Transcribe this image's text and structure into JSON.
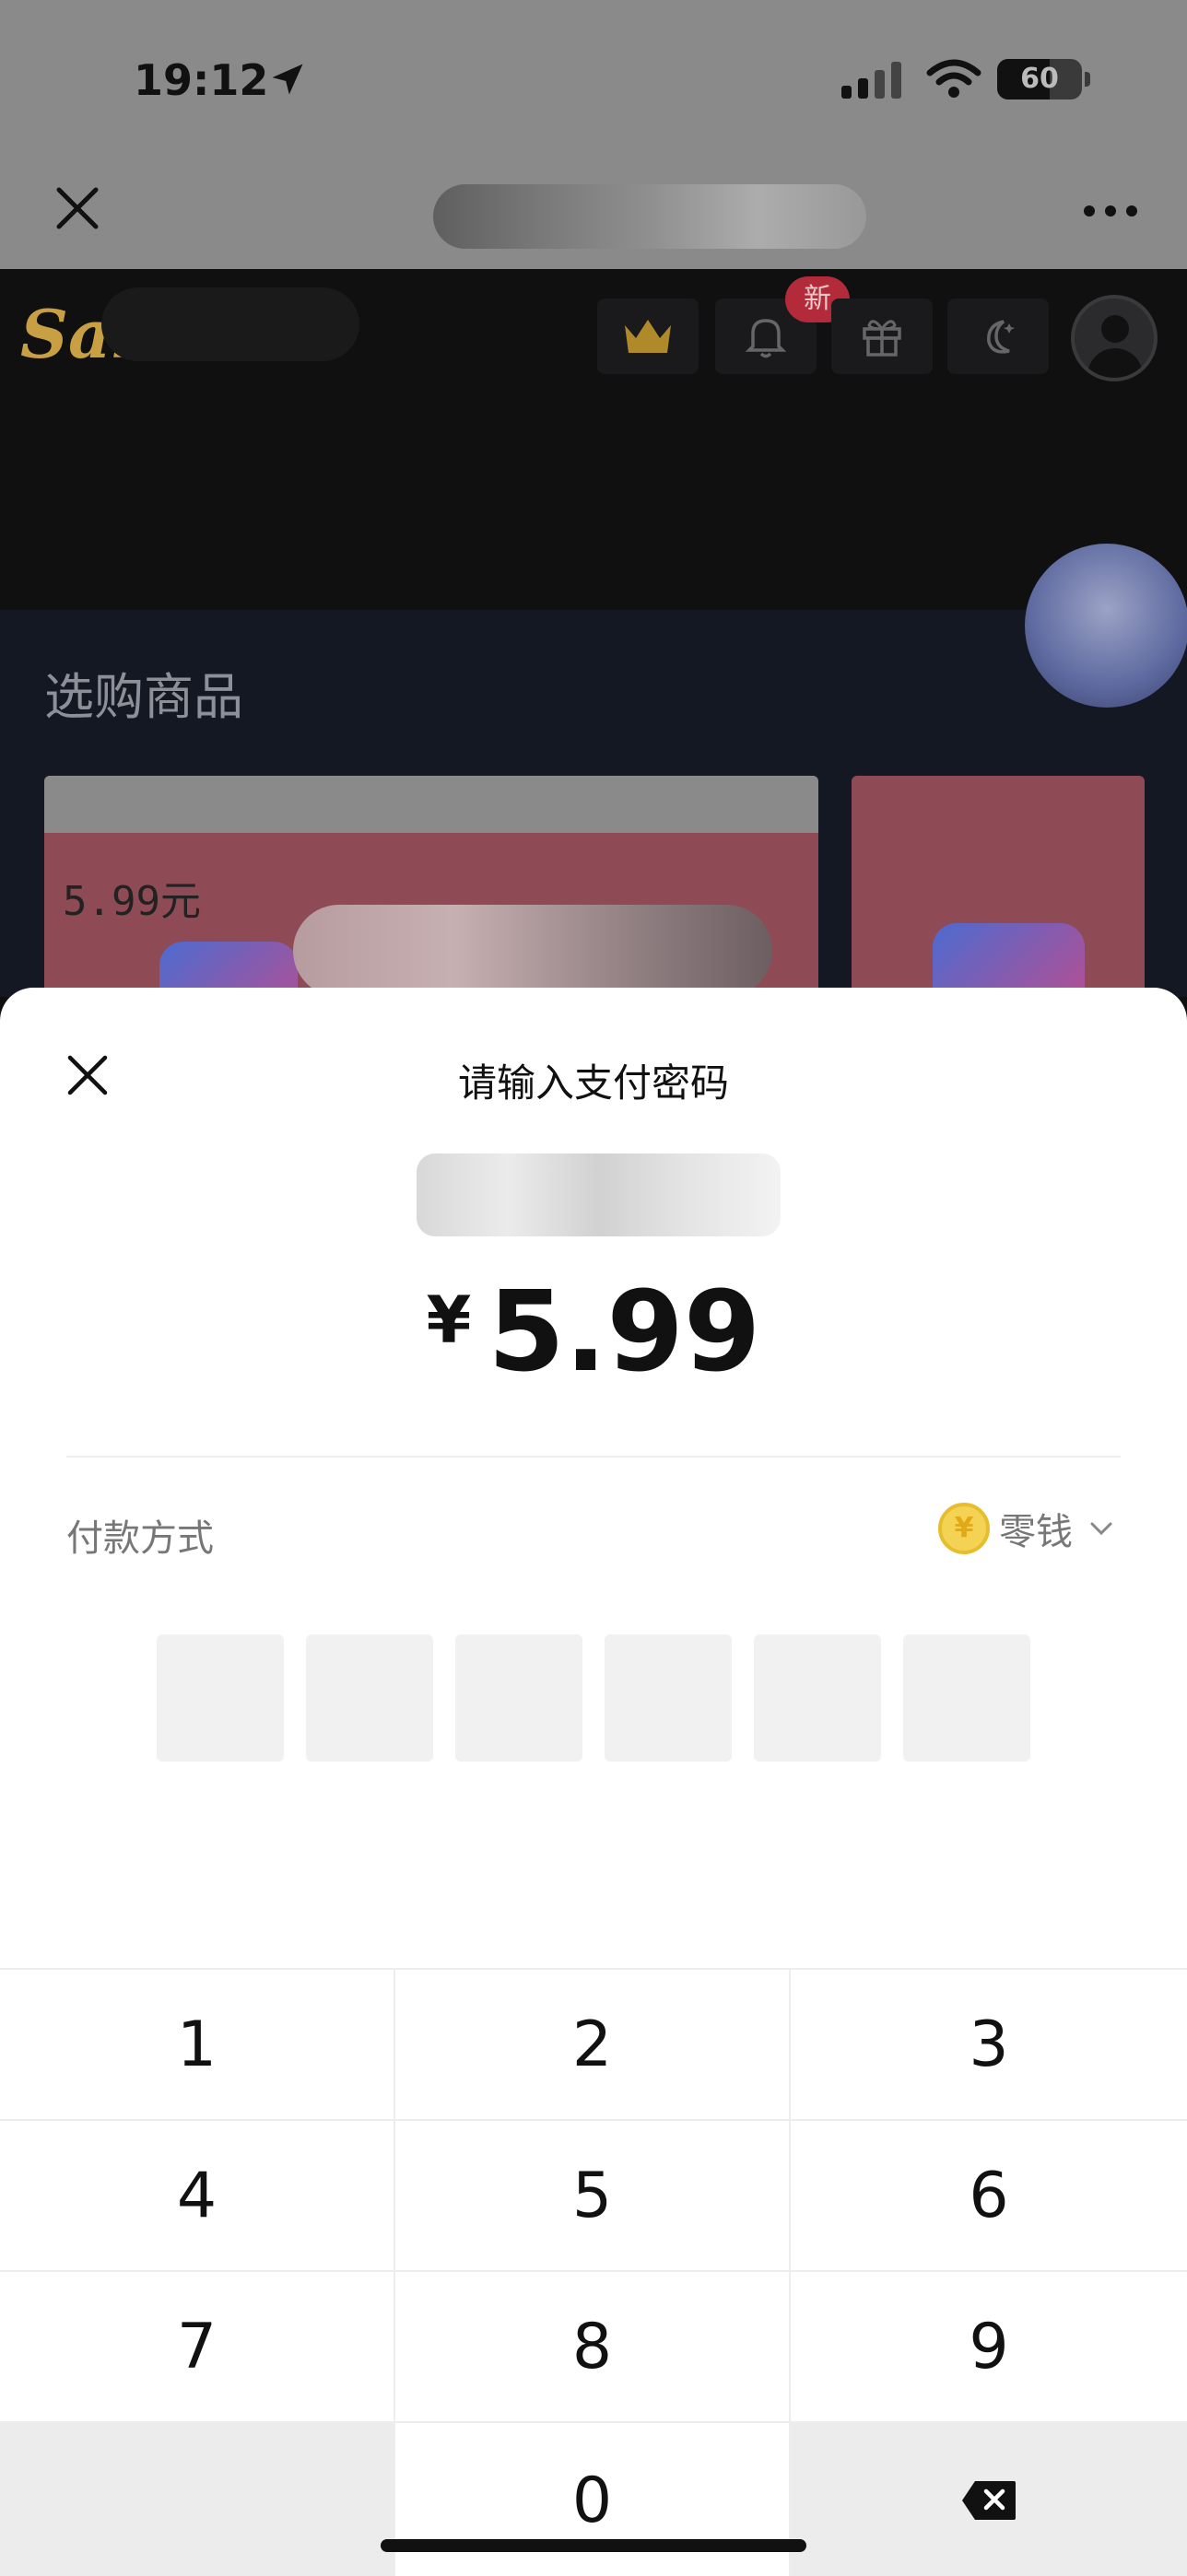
{
  "status_bar": {
    "time": "19:12",
    "battery": "60"
  },
  "background": {
    "section_title": "选购商品",
    "product_price": "5.99元",
    "notification_badge": "新"
  },
  "payment_sheet": {
    "title": "请输入支付密码",
    "currency_symbol": "¥",
    "amount": "5.99",
    "payment_method_label": "付款方式",
    "payment_method_value": "零钱",
    "coin_symbol": "¥",
    "pin_length": 6
  },
  "keypad": {
    "keys": [
      "1",
      "2",
      "3",
      "4",
      "5",
      "6",
      "7",
      "8",
      "9",
      "0"
    ]
  },
  "colors": {
    "sheet_bg": "#ffffff",
    "keypad_gray": "#ececec",
    "coin": "#f4d354"
  },
  "icons": [
    "close-icon",
    "more-icon",
    "crown-icon",
    "bell-icon",
    "gift-icon",
    "moon-icon",
    "user-icon",
    "chevron-down-icon",
    "backspace-icon",
    "location-arrow-icon",
    "signal-icon",
    "wifi-icon",
    "battery-icon"
  ]
}
